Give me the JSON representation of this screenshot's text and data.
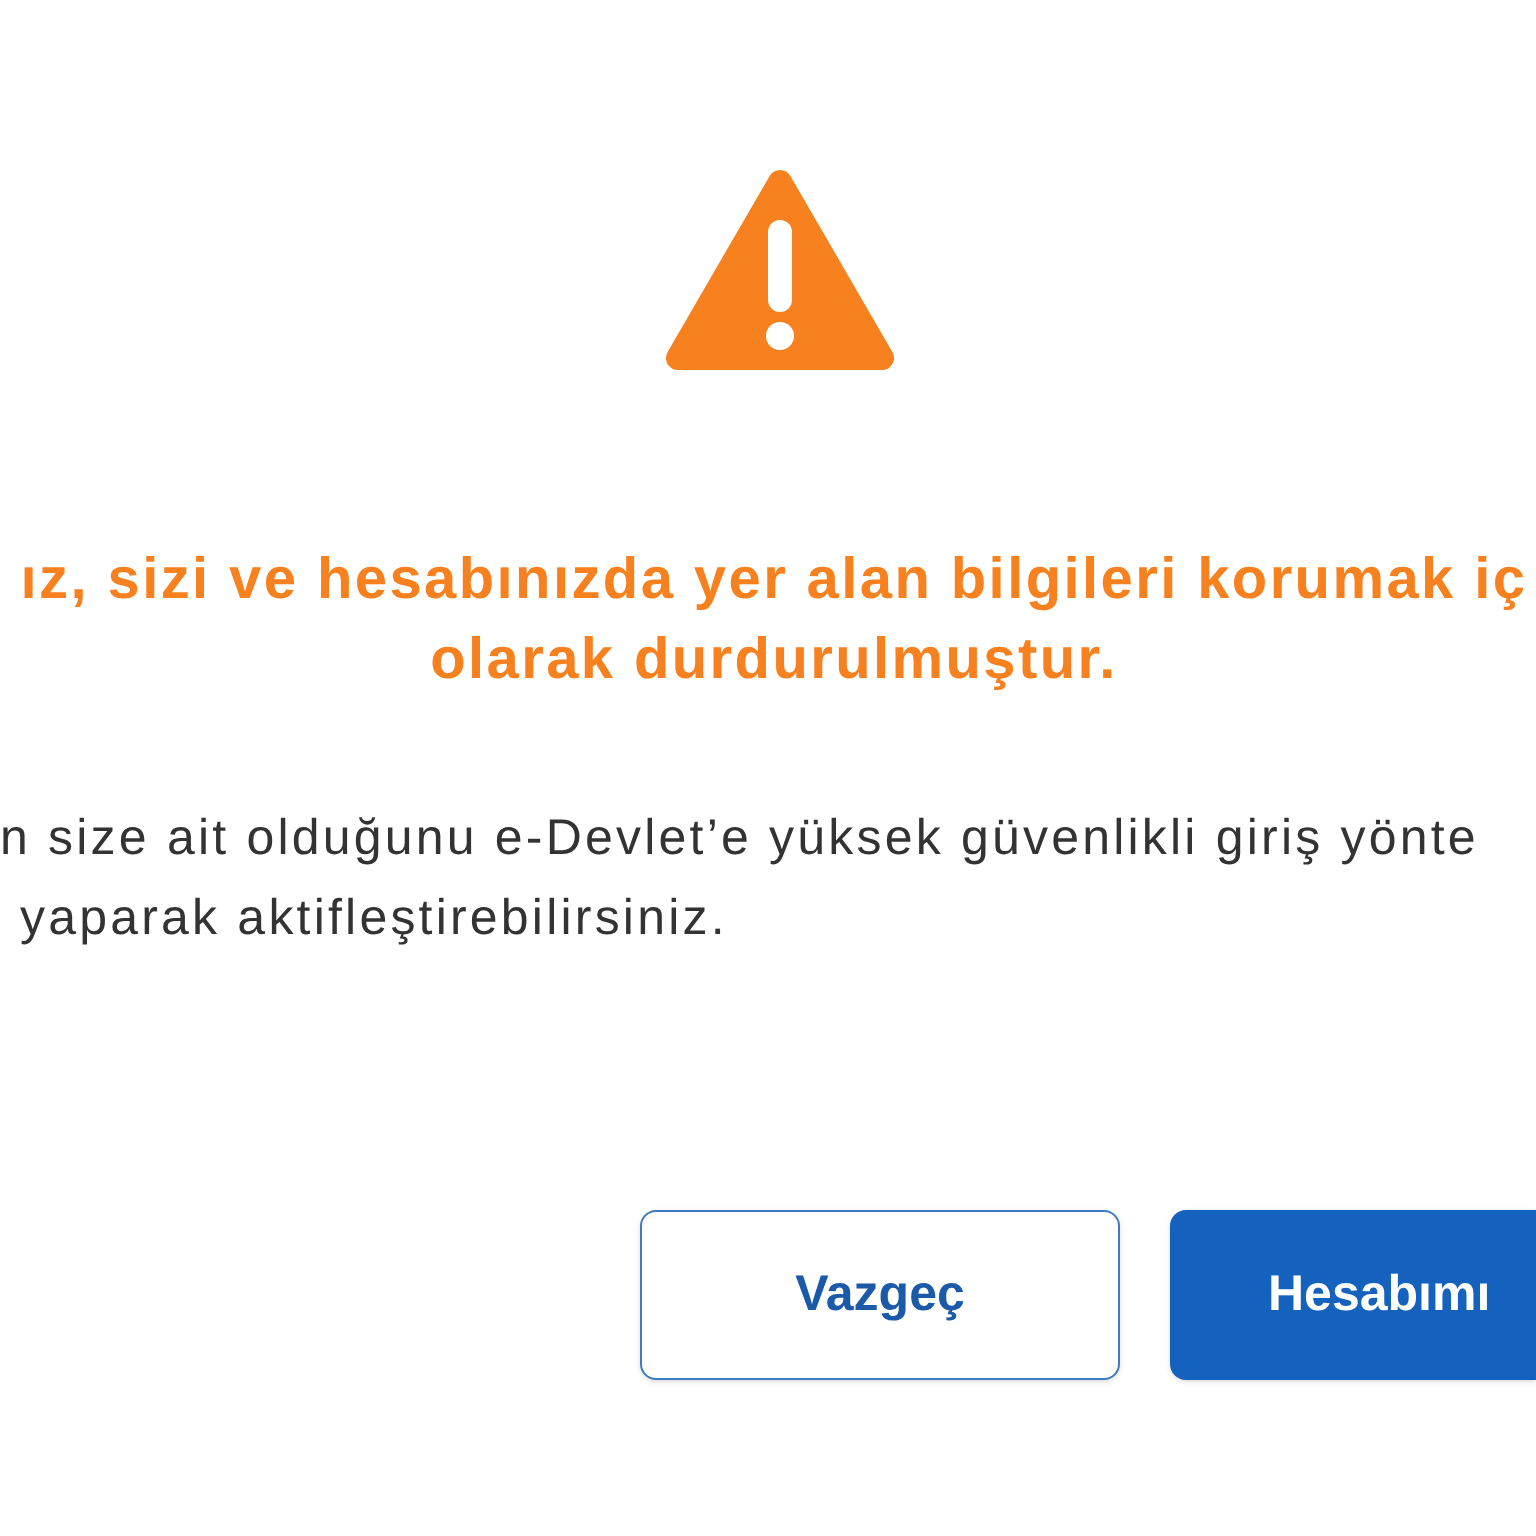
{
  "heading_lines": [
    "ız, sizi ve hesabınızda yer alan bilgileri korumak iç",
    "olarak durdurulmuştur."
  ],
  "body_lines": [
    "n size ait olduğunu e-Devlet’e yüksek güvenlikli giriş yönte",
    "yaparak aktifleştirebilirsiniz."
  ],
  "buttons": [
    {
      "label": "Vazgeç",
      "kind": "secondary"
    },
    {
      "label": "Hesabımı",
      "kind": "primary"
    }
  ]
}
